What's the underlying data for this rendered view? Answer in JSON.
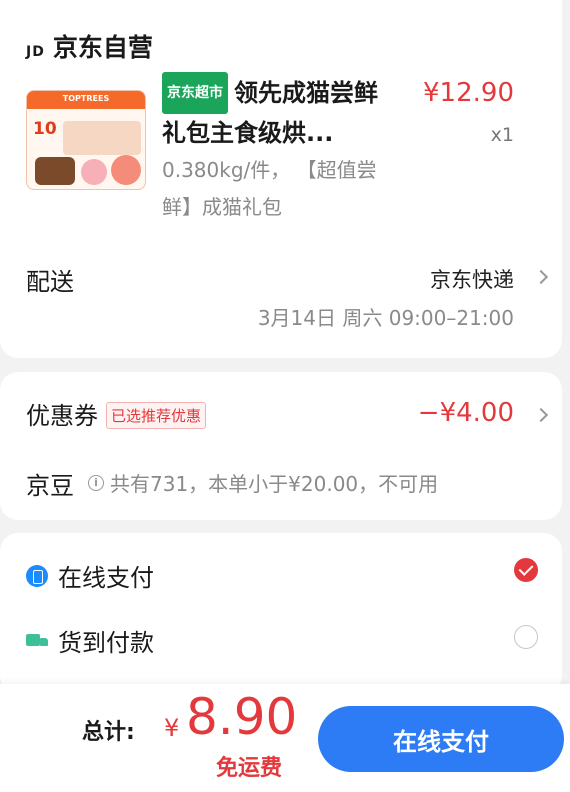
{
  "store": {
    "logo": "JD",
    "name": "京东自营"
  },
  "product": {
    "thumbnail_brand": "TOPTREES",
    "thumbnail_number": "10",
    "tag": "京东超市",
    "title": "领先成猫尝鲜礼包主食级烘...",
    "description": "0.380kg/件， 【超值尝鲜】成猫礼包",
    "price": "¥12.90",
    "quantity": "x1"
  },
  "delivery": {
    "label": "配送",
    "method": "京东快递",
    "time": "3月14日 周六 09:00–21:00"
  },
  "coupon": {
    "label": "优惠券",
    "tag": "已选推荐优惠",
    "value": "−¥4.00"
  },
  "jingdou": {
    "label": "京豆",
    "info": "共有731，本单小于¥20.00，不可用"
  },
  "payment": {
    "options": [
      {
        "label": "在线支付",
        "icon": "phone-pay-icon",
        "selected": true
      },
      {
        "label": "货到付款",
        "icon": "truck-icon",
        "selected": false
      }
    ]
  },
  "footer": {
    "total_label": "总计:",
    "currency": "¥",
    "total_amount": "8.90",
    "shipping_note": "免运费",
    "pay_button": "在线支付"
  },
  "colors": {
    "accent_red": "#e4393c",
    "pay_button_blue": "#2d7cf6",
    "supermarket_green": "#1aa55a"
  }
}
